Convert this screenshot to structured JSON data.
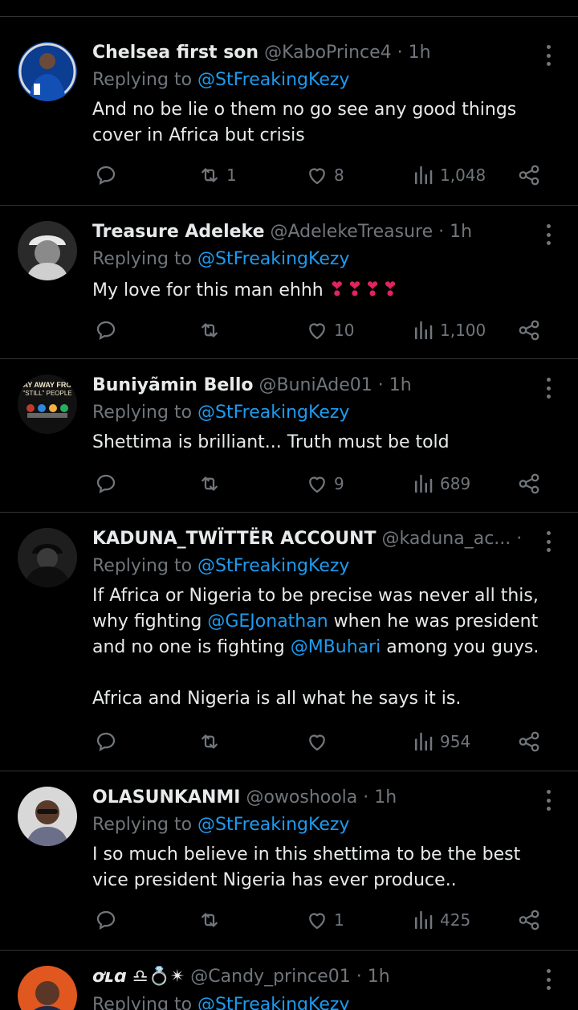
{
  "common": {
    "replying_prefix": "Replying to",
    "replying_handle": "@StFreakingKezy",
    "dot": "·"
  },
  "tweets": [
    {
      "name": "Chelsea first son",
      "handle": "@KaboPrince4",
      "time": "1h",
      "text": "And no be lie o them no go see any good things cover in Africa but crisis",
      "retweets": "1",
      "likes": "8",
      "views": "1,048",
      "avatar": "chelsea-player-avatar"
    },
    {
      "name": "Treasure Adeleke",
      "handle": "@AdelekeTreasure",
      "time": "1h",
      "text": "My love for this man ehhh",
      "emoji": "❣❣❣❣",
      "retweets": "",
      "likes": "10",
      "views": "1,100",
      "avatar": "man-with-cap-avatar"
    },
    {
      "name": "Buniyãmin Bello",
      "handle": "@BuniAde01",
      "time": "1h",
      "text": "Shettima is brilliant... Truth must be told",
      "retweets": "",
      "likes": "9",
      "views": "689",
      "avatar": "movie-poster-avatar",
      "avatar_text_1": "AY AWAY FRO",
      "avatar_text_2": "\"STILL\" PEOPLE"
    },
    {
      "name": "KADUNA_TWÏTTËR ACCOUNT",
      "handle": "@kaduna_ac...",
      "time": "1h",
      "text_parts": {
        "p1_a": "If Africa or Nigeria to be precise was never all this, why fighting ",
        "p1_m1": "@GEJonathan",
        "p1_b": " when he was president and no one is fighting ",
        "p1_m2": "@MBuhari",
        "p1_c": " among you guys.",
        "p2": "Africa and Nigeria is all what he says it is."
      },
      "retweets": "",
      "likes": "",
      "views": "954",
      "avatar": "masked-figure-avatar"
    },
    {
      "name": "OLASUNKANMI",
      "handle": "@owoshoola",
      "time": "1h",
      "text": "I so much believe in this shettima to be the best vice president Nigeria has ever produce..",
      "retweets": "",
      "likes": "1",
      "views": "425",
      "avatar": "man-with-sunglasses-avatar"
    },
    {
      "name": "ơʟɑ",
      "name_emoji": "♎💍✴",
      "handle": "@Candy_prince01",
      "time": "1h",
      "avatar": "man-orange-background-avatar"
    }
  ],
  "colors": {
    "background": "#000000",
    "text": "#e7e9ea",
    "muted": "#71767b",
    "link": "#1d9bf0",
    "divider": "#2f3336",
    "heart_emoji": "#e0245e"
  }
}
